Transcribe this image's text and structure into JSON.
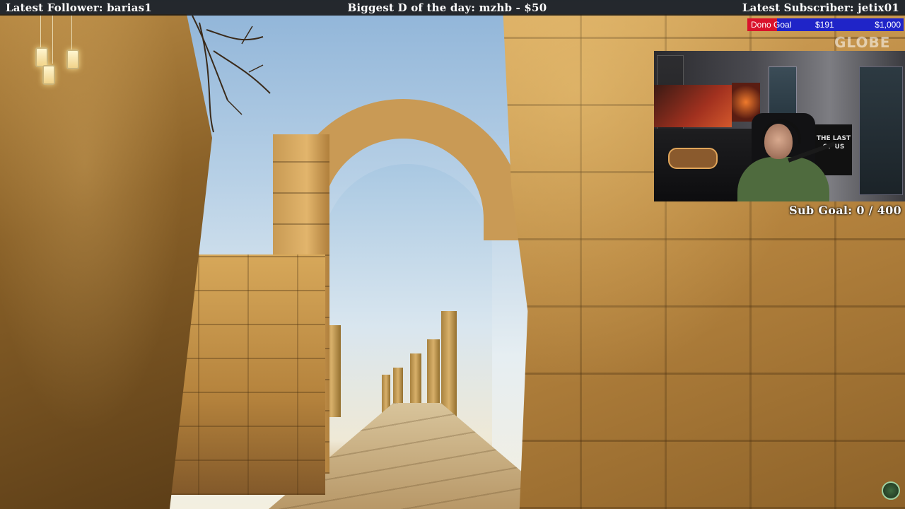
{
  "ticker": {
    "latest_follower": "Latest Follower: barias1",
    "biggest_donation": "Biggest D of the day: mzhb - $50",
    "latest_subscriber": "Latest Subscriber: jetix01"
  },
  "dono_goal": {
    "label": "Dono Goal",
    "current": "$191",
    "target": "$1,000",
    "progress_fraction": 0.191,
    "fill_color": "#d9122b",
    "track_color": "#1f24c8"
  },
  "watermark": {
    "text": "GLOBE"
  },
  "webcam": {
    "poster_text": "THE LAST OF US"
  },
  "sub_goal": {
    "text": "Sub Goal: 0 / 400"
  },
  "scene": {
    "icons": [
      "hanging-lantern-icon",
      "globe-logo-icon"
    ]
  }
}
